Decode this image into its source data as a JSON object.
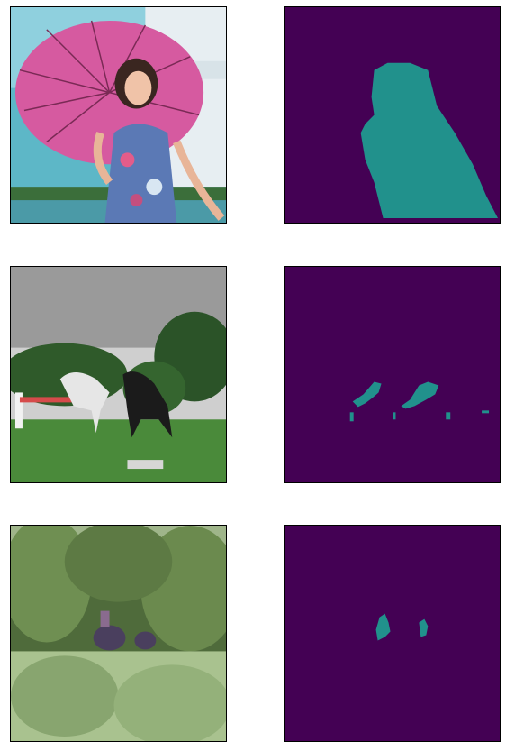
{
  "figure": {
    "rows": [
      {
        "photo": {
          "description_icon": "photo-umbrella-woman"
        },
        "mask": {
          "description_icon": "mask-person"
        }
      },
      {
        "photo": {
          "description_icon": "photo-horses-field"
        },
        "mask": {
          "description_icon": "mask-horses"
        }
      },
      {
        "photo": {
          "description_icon": "photo-jungle-elephants"
        },
        "mask": {
          "description_icon": "mask-elephants"
        }
      }
    ]
  },
  "colors": {
    "mask_background": "#440154",
    "mask_foreground": "#21918c"
  }
}
